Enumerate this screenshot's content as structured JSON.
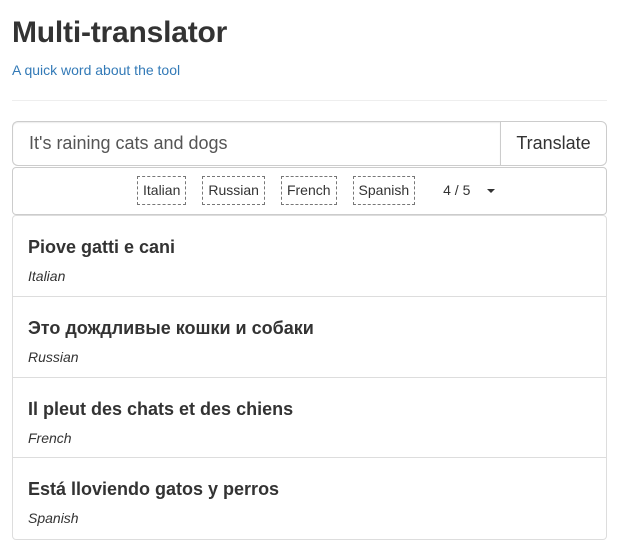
{
  "header": {
    "title": "Multi-translator",
    "subtitle": "A quick word about the tool"
  },
  "search": {
    "value": "It's raining cats and dogs",
    "button_label": "Translate"
  },
  "languages": {
    "tags": [
      "Italian",
      "Russian",
      "French",
      "Spanish"
    ],
    "count": "4 / 5"
  },
  "results": [
    {
      "text": "Piove gatti e cani",
      "lang": "Italian"
    },
    {
      "text": "Это дождливые кошки и собаки",
      "lang": "Russian"
    },
    {
      "text": "Il pleut des chats et des chiens",
      "lang": "French"
    },
    {
      "text": "Está lloviendo gatos y perros",
      "lang": "Spanish"
    }
  ],
  "colors": {
    "link": "#337ab7",
    "text": "#333333",
    "border": "#cccccc"
  }
}
